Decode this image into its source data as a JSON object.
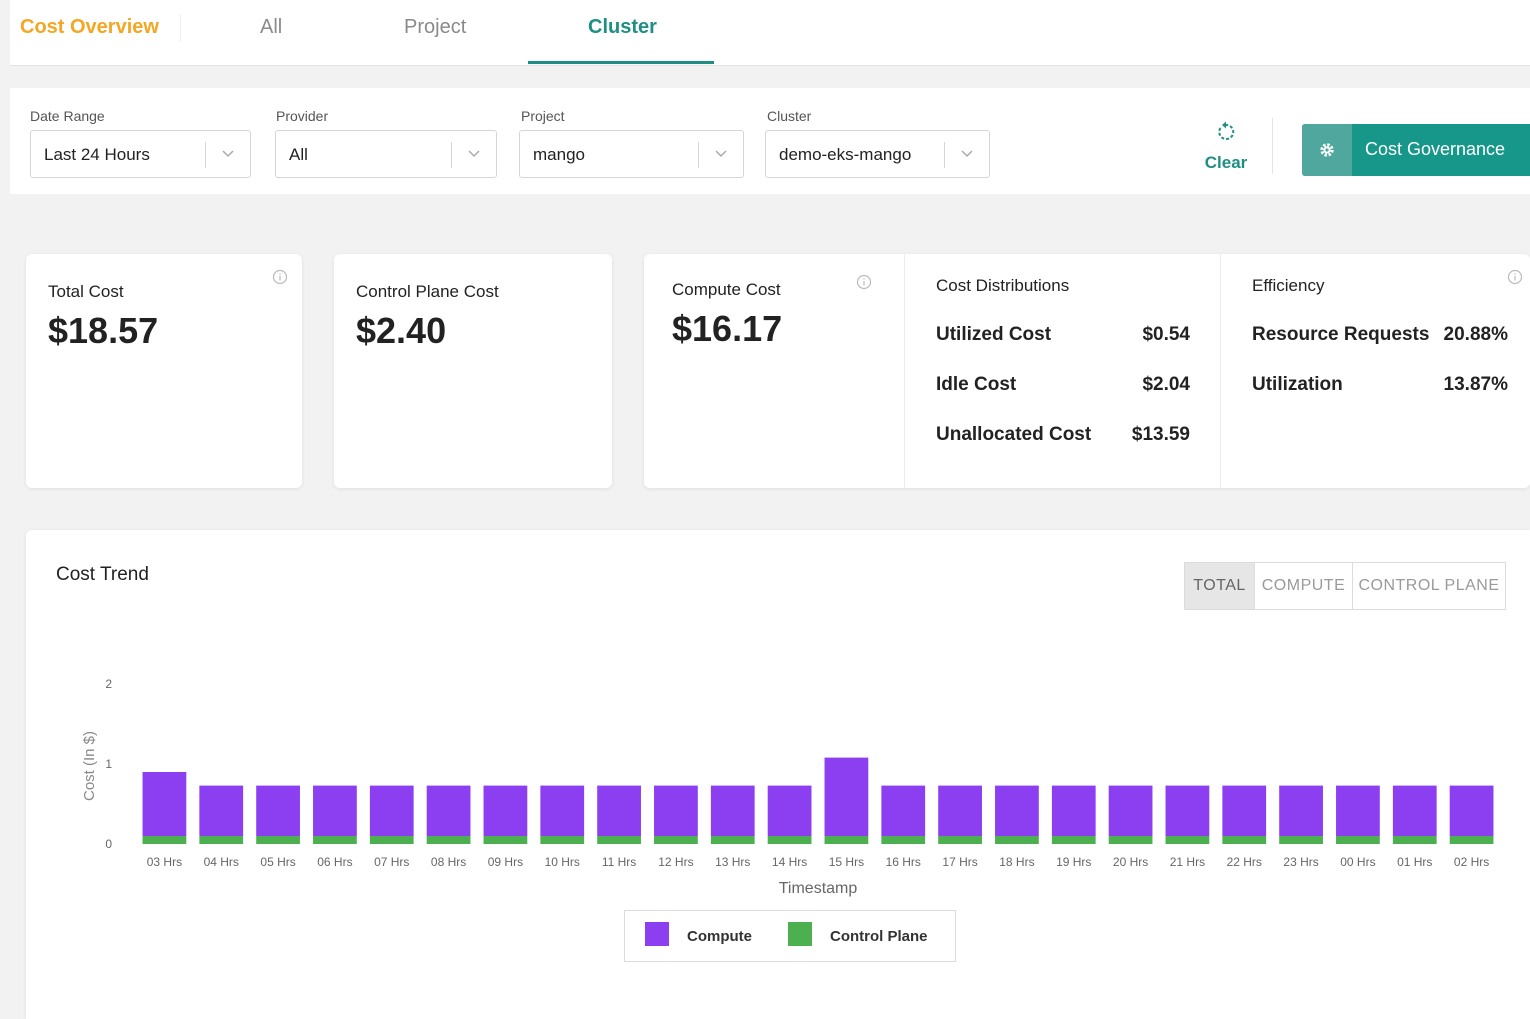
{
  "nav": {
    "brand": "Cost Overview",
    "tabs": [
      {
        "label": "All"
      },
      {
        "label": "Project"
      },
      {
        "label": "Cluster"
      }
    ]
  },
  "filters": {
    "date_range": {
      "label": "Date Range",
      "value": "Last 24 Hours"
    },
    "provider": {
      "label": "Provider",
      "value": "All"
    },
    "project": {
      "label": "Project",
      "value": "mango"
    },
    "cluster": {
      "label": "Cluster",
      "value": "demo-eks-mango"
    },
    "clear_label": "Clear",
    "governance_label": "Cost Governance"
  },
  "cards": {
    "total": {
      "title": "Total Cost",
      "value": "$18.57"
    },
    "control_plane": {
      "title": "Control Plane Cost",
      "value": "$2.40"
    },
    "compute": {
      "title": "Compute Cost",
      "value": "$16.17"
    },
    "distributions": {
      "title": "Cost Distributions",
      "rows": [
        {
          "label": "Utilized Cost",
          "value": "$0.54"
        },
        {
          "label": "Idle Cost",
          "value": "$2.04"
        },
        {
          "label": "Unallocated Cost",
          "value": "$13.59"
        }
      ]
    },
    "efficiency": {
      "title": "Efficiency",
      "rows": [
        {
          "label": "Resource Requests",
          "value": "20.88%"
        },
        {
          "label": "Utilization",
          "value": "13.87%"
        }
      ]
    }
  },
  "trend": {
    "title": "Cost Trend",
    "toggle": [
      "TOTAL",
      "COMPUTE",
      "CONTROL PLANE"
    ],
    "active_toggle": "TOTAL"
  },
  "colors": {
    "brand": "#f5a623",
    "accent": "#1f8f84",
    "compute": "#8c3ff0",
    "control_plane": "#4caf50"
  },
  "chart_data": {
    "type": "bar",
    "stacked": true,
    "title": "",
    "xlabel": "Timestamp",
    "ylabel": "Cost (In $)",
    "ylim": [
      0,
      2
    ],
    "yticks": [
      0,
      1,
      2
    ],
    "grid": false,
    "legend_position": "bottom",
    "categories": [
      "03 Hrs",
      "04 Hrs",
      "05 Hrs",
      "06 Hrs",
      "07 Hrs",
      "08 Hrs",
      "09 Hrs",
      "10 Hrs",
      "11 Hrs",
      "12 Hrs",
      "13 Hrs",
      "14 Hrs",
      "15 Hrs",
      "16 Hrs",
      "17 Hrs",
      "18 Hrs",
      "19 Hrs",
      "20 Hrs",
      "21 Hrs",
      "22 Hrs",
      "23 Hrs",
      "00 Hrs",
      "01 Hrs",
      "02 Hrs"
    ],
    "series": [
      {
        "name": "Control Plane",
        "color": "#4caf50",
        "values": [
          0.1,
          0.1,
          0.1,
          0.1,
          0.1,
          0.1,
          0.1,
          0.1,
          0.1,
          0.1,
          0.1,
          0.1,
          0.1,
          0.1,
          0.1,
          0.1,
          0.1,
          0.1,
          0.1,
          0.1,
          0.1,
          0.1,
          0.1,
          0.1
        ]
      },
      {
        "name": "Compute",
        "color": "#8c3ff0",
        "values": [
          0.8,
          0.63,
          0.63,
          0.63,
          0.63,
          0.63,
          0.63,
          0.63,
          0.63,
          0.63,
          0.63,
          0.63,
          0.98,
          0.63,
          0.63,
          0.63,
          0.63,
          0.63,
          0.63,
          0.63,
          0.63,
          0.63,
          0.63,
          0.63
        ]
      }
    ]
  }
}
